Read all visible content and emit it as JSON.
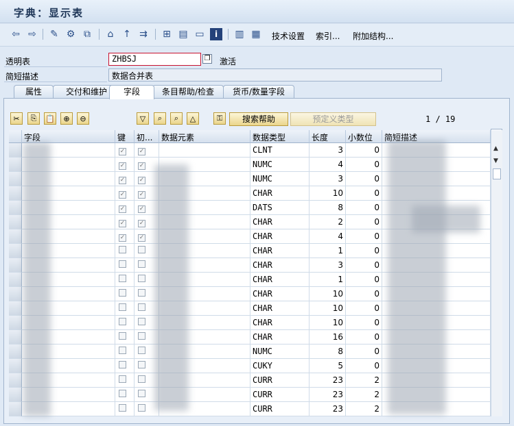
{
  "window": {
    "title": "字典：显示表"
  },
  "toolbar": {
    "icons": [
      "back-arrow-icon",
      "forward-arrow-icon",
      "edit-pencil-icon",
      "activate-icon",
      "other-object-icon",
      "where-used-icon",
      "navigate-icon",
      "tree-icon",
      "hierarchy-icon",
      "print-icon",
      "display-object-list-icon",
      "info-icon",
      "layout-icon",
      "table-icon"
    ],
    "tech_settings": "技术设置",
    "index": "索引...",
    "append": "附加结构..."
  },
  "form": {
    "table_label": "透明表",
    "table_value": "ZHBSJ",
    "status": "激活",
    "desc_label": "简短描述",
    "desc_value": "数据合并表"
  },
  "tabs": [
    "属性",
    "交付和维护",
    "字段",
    "条目帮助/检查",
    "货币/数量字段"
  ],
  "active_tab": "字段",
  "grid_toolbar": {
    "search_help": "搜索帮助",
    "predefined_type": "预定义类型",
    "counter": "1 / 19"
  },
  "columns": [
    "字段",
    "键",
    "初...",
    "数据元素",
    "数据类型",
    "长度",
    "小数位",
    "简短描述"
  ],
  "rows": [
    {
      "field": "",
      "key": true,
      "init": true,
      "element": "",
      "type": "CLNT",
      "len": "3",
      "dec": "0",
      "desc": ""
    },
    {
      "field": "",
      "key": true,
      "init": true,
      "element": "",
      "type": "NUMC",
      "len": "4",
      "dec": "0",
      "desc": ""
    },
    {
      "field": "",
      "key": true,
      "init": true,
      "element": "",
      "type": "NUMC",
      "len": "3",
      "dec": "0",
      "desc": ""
    },
    {
      "field": "",
      "key": true,
      "init": true,
      "element": "",
      "type": "CHAR",
      "len": "10",
      "dec": "0",
      "desc": ""
    },
    {
      "field": "",
      "key": true,
      "init": true,
      "element": "",
      "type": "DATS",
      "len": "8",
      "dec": "0",
      "desc": ""
    },
    {
      "field": "",
      "key": true,
      "init": true,
      "element": "",
      "type": "CHAR",
      "len": "2",
      "dec": "0",
      "desc": ""
    },
    {
      "field": "",
      "key": true,
      "init": true,
      "element": "",
      "type": "CHAR",
      "len": "4",
      "dec": "0",
      "desc": ""
    },
    {
      "field": "",
      "key": false,
      "init": false,
      "element": "",
      "type": "CHAR",
      "len": "1",
      "dec": "0",
      "desc": ""
    },
    {
      "field": "",
      "key": false,
      "init": false,
      "element": "",
      "type": "CHAR",
      "len": "3",
      "dec": "0",
      "desc": ""
    },
    {
      "field": "",
      "key": false,
      "init": false,
      "element": "",
      "type": "CHAR",
      "len": "1",
      "dec": "0",
      "desc": ""
    },
    {
      "field": "",
      "key": false,
      "init": false,
      "element": "",
      "type": "CHAR",
      "len": "10",
      "dec": "0",
      "desc": ""
    },
    {
      "field": "",
      "key": false,
      "init": false,
      "element": "",
      "type": "CHAR",
      "len": "10",
      "dec": "0",
      "desc": ""
    },
    {
      "field": "",
      "key": false,
      "init": false,
      "element": "",
      "type": "CHAR",
      "len": "10",
      "dec": "0",
      "desc": ""
    },
    {
      "field": "",
      "key": false,
      "init": false,
      "element": "",
      "type": "CHAR",
      "len": "16",
      "dec": "0",
      "desc": ""
    },
    {
      "field": "",
      "key": false,
      "init": false,
      "element": "",
      "type": "NUMC",
      "len": "8",
      "dec": "0",
      "desc": ""
    },
    {
      "field": "",
      "key": false,
      "init": false,
      "element": "",
      "type": "CUKY",
      "len": "5",
      "dec": "0",
      "desc": ""
    },
    {
      "field": "",
      "key": false,
      "init": false,
      "element": "",
      "type": "CURR",
      "len": "23",
      "dec": "2",
      "desc": ""
    },
    {
      "field": "",
      "key": false,
      "init": false,
      "element": "",
      "type": "CURR",
      "len": "23",
      "dec": "2",
      "desc": ""
    },
    {
      "field": "",
      "key": false,
      "init": false,
      "element": "",
      "type": "CURR",
      "len": "23",
      "dec": "2",
      "desc": ""
    }
  ]
}
